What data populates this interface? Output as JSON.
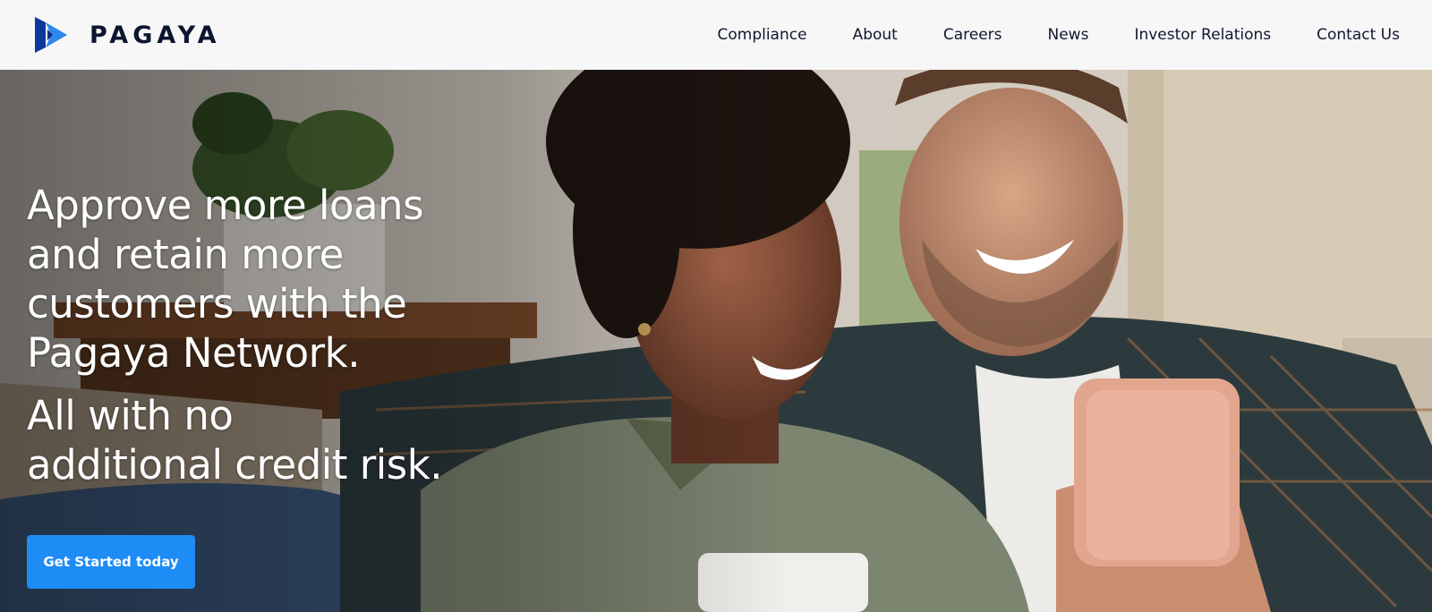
{
  "brand": {
    "name": "PAGAYA",
    "logo_icon": "pagaya-play-triangle-icon",
    "primary_color": "#0c1530",
    "accent_color": "#1e8cf5"
  },
  "nav": {
    "items": [
      {
        "label": "Compliance"
      },
      {
        "label": "About"
      },
      {
        "label": "Careers"
      },
      {
        "label": "News"
      },
      {
        "label": "Investor Relations"
      },
      {
        "label": "Contact Us"
      }
    ]
  },
  "hero": {
    "headline_lines": [
      "Approve more loans",
      "and retain more",
      "customers with the",
      "Pagaya Network."
    ],
    "subheadline_lines": [
      "All with no",
      "additional credit risk."
    ],
    "cta_label": "Get Started today",
    "image": "couple-smiling-at-phone-photo"
  }
}
